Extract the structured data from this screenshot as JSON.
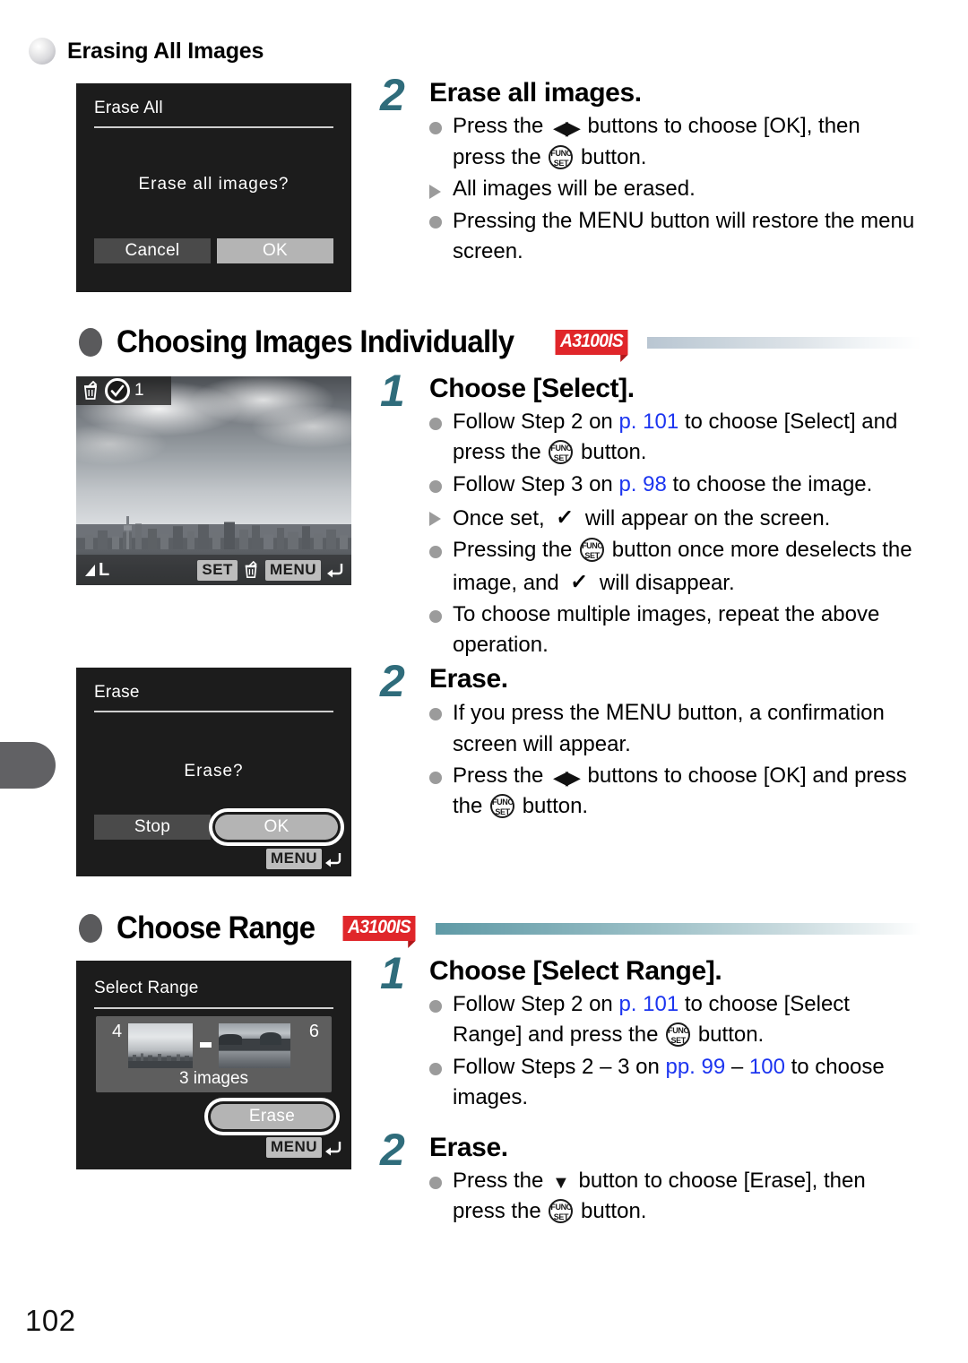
{
  "page": {
    "number": "102"
  },
  "section_erase_all": {
    "heading": "Erasing All Images",
    "screen": {
      "title": "Erase All",
      "message": "Erase all images?",
      "cancel_label": "Cancel",
      "ok_label": "OK"
    },
    "step": {
      "number": "2",
      "heading": "Erase all images.",
      "bullets": [
        {
          "marker": "dot",
          "parts": [
            {
              "t": "text",
              "v": "Press the "
            },
            {
              "t": "lr-arrows",
              "v": "◀▶"
            },
            {
              "t": "text",
              "v": " buttons to choose [OK], then press the "
            },
            {
              "t": "funcset",
              "v": "FUNC SET"
            },
            {
              "t": "text",
              "v": " button."
            }
          ]
        },
        {
          "marker": "tri",
          "parts": [
            {
              "t": "text",
              "v": "All images will be erased."
            }
          ]
        },
        {
          "marker": "dot",
          "parts": [
            {
              "t": "text",
              "v": "Pressing the "
            },
            {
              "t": "menu",
              "v": "MENU"
            },
            {
              "t": "text",
              "v": " button will restore the menu screen."
            }
          ]
        }
      ]
    }
  },
  "section_individually": {
    "heading": "Choosing Images Individually",
    "model_badge": "A3100IS",
    "bar_style": "blue",
    "photo_screen": {
      "trash_icon": "trash-icon",
      "check_icon": "check-circle-icon",
      "count": "1",
      "quality_label": "L",
      "set_chip": "SET",
      "menu_chip": "MENU",
      "back_arrow": "↰"
    },
    "erase_screen": {
      "title": "Erase",
      "message": "Erase?",
      "stop_label": "Stop",
      "ok_label": "OK",
      "menu_chip": "MENU",
      "back_arrow": "↰"
    },
    "step1": {
      "number": "1",
      "heading": "Choose [Select].",
      "bullets": [
        {
          "marker": "dot",
          "parts": [
            {
              "t": "text",
              "v": "Follow Step 2 on "
            },
            {
              "t": "page-ref",
              "v": "p. 101"
            },
            {
              "t": "text",
              "v": " to choose [Select] and press the "
            },
            {
              "t": "funcset",
              "v": "FUNC SET"
            },
            {
              "t": "text",
              "v": " button."
            }
          ]
        },
        {
          "marker": "dot",
          "parts": [
            {
              "t": "text",
              "v": "Follow Step 3 on "
            },
            {
              "t": "page-ref",
              "v": "p. 98"
            },
            {
              "t": "text",
              "v": " to choose the image."
            }
          ]
        },
        {
          "marker": "tri",
          "parts": [
            {
              "t": "text",
              "v": "Once set, "
            },
            {
              "t": "check",
              "v": "✓"
            },
            {
              "t": "text",
              "v": " will appear on the screen."
            }
          ]
        },
        {
          "marker": "dot",
          "parts": [
            {
              "t": "text",
              "v": "Pressing the "
            },
            {
              "t": "funcset",
              "v": "FUNC SET"
            },
            {
              "t": "text",
              "v": " button once more deselects the image, and "
            },
            {
              "t": "check",
              "v": "✓"
            },
            {
              "t": "text",
              "v": " will disappear."
            }
          ]
        },
        {
          "marker": "dot",
          "parts": [
            {
              "t": "text",
              "v": "To choose multiple images, repeat the above operation."
            }
          ]
        }
      ]
    },
    "step2": {
      "number": "2",
      "heading": "Erase.",
      "bullets": [
        {
          "marker": "dot",
          "parts": [
            {
              "t": "text",
              "v": "If you press the "
            },
            {
              "t": "menu",
              "v": "MENU"
            },
            {
              "t": "text",
              "v": " button, a confirmation screen will appear."
            }
          ]
        },
        {
          "marker": "dot",
          "parts": [
            {
              "t": "text",
              "v": "Press the "
            },
            {
              "t": "lr-arrows",
              "v": "◀▶"
            },
            {
              "t": "text",
              "v": " buttons to choose [OK] and press the "
            },
            {
              "t": "funcset",
              "v": "FUNC SET"
            },
            {
              "t": "text",
              "v": " button."
            }
          ]
        }
      ]
    }
  },
  "section_range": {
    "heading": "Choose Range",
    "model_badge": "A3100IS",
    "bar_style": "teal",
    "screen": {
      "title": "Select Range",
      "start_index": "4",
      "end_index": "6",
      "separator": "–",
      "count_label": "3 images",
      "erase_label": "Erase",
      "menu_chip": "MENU",
      "back_arrow": "↰"
    },
    "step1": {
      "number": "1",
      "heading": "Choose [Select Range].",
      "bullets": [
        {
          "marker": "dot",
          "parts": [
            {
              "t": "text",
              "v": "Follow Step 2 on "
            },
            {
              "t": "page-ref",
              "v": "p. 101"
            },
            {
              "t": "text",
              "v": " to choose [Select Range] and press the "
            },
            {
              "t": "funcset",
              "v": "FUNC SET"
            },
            {
              "t": "text",
              "v": " button."
            }
          ]
        },
        {
          "marker": "dot",
          "parts": [
            {
              "t": "text",
              "v": "Follow Steps 2 – 3 on "
            },
            {
              "t": "page-ref",
              "v": "pp. 99"
            },
            {
              "t": "text",
              "v": " – "
            },
            {
              "t": "page-ref",
              "v": "100"
            },
            {
              "t": "text",
              "v": " to choose images."
            }
          ]
        }
      ]
    },
    "step2": {
      "number": "2",
      "heading": "Erase.",
      "bullets": [
        {
          "marker": "dot",
          "parts": [
            {
              "t": "text",
              "v": "Press the "
            },
            {
              "t": "dn-arrow",
              "v": "▼"
            },
            {
              "t": "text",
              "v": " button to choose [Erase], then press the "
            },
            {
              "t": "funcset",
              "v": "FUNC SET"
            },
            {
              "t": "text",
              "v": " button."
            }
          ]
        }
      ]
    }
  },
  "colors": {
    "step_number": "#2f6c7b",
    "page_link": "#1c35f0",
    "model_badge_bg": "#e0262a",
    "screen_bg": "#1c1c1c"
  }
}
